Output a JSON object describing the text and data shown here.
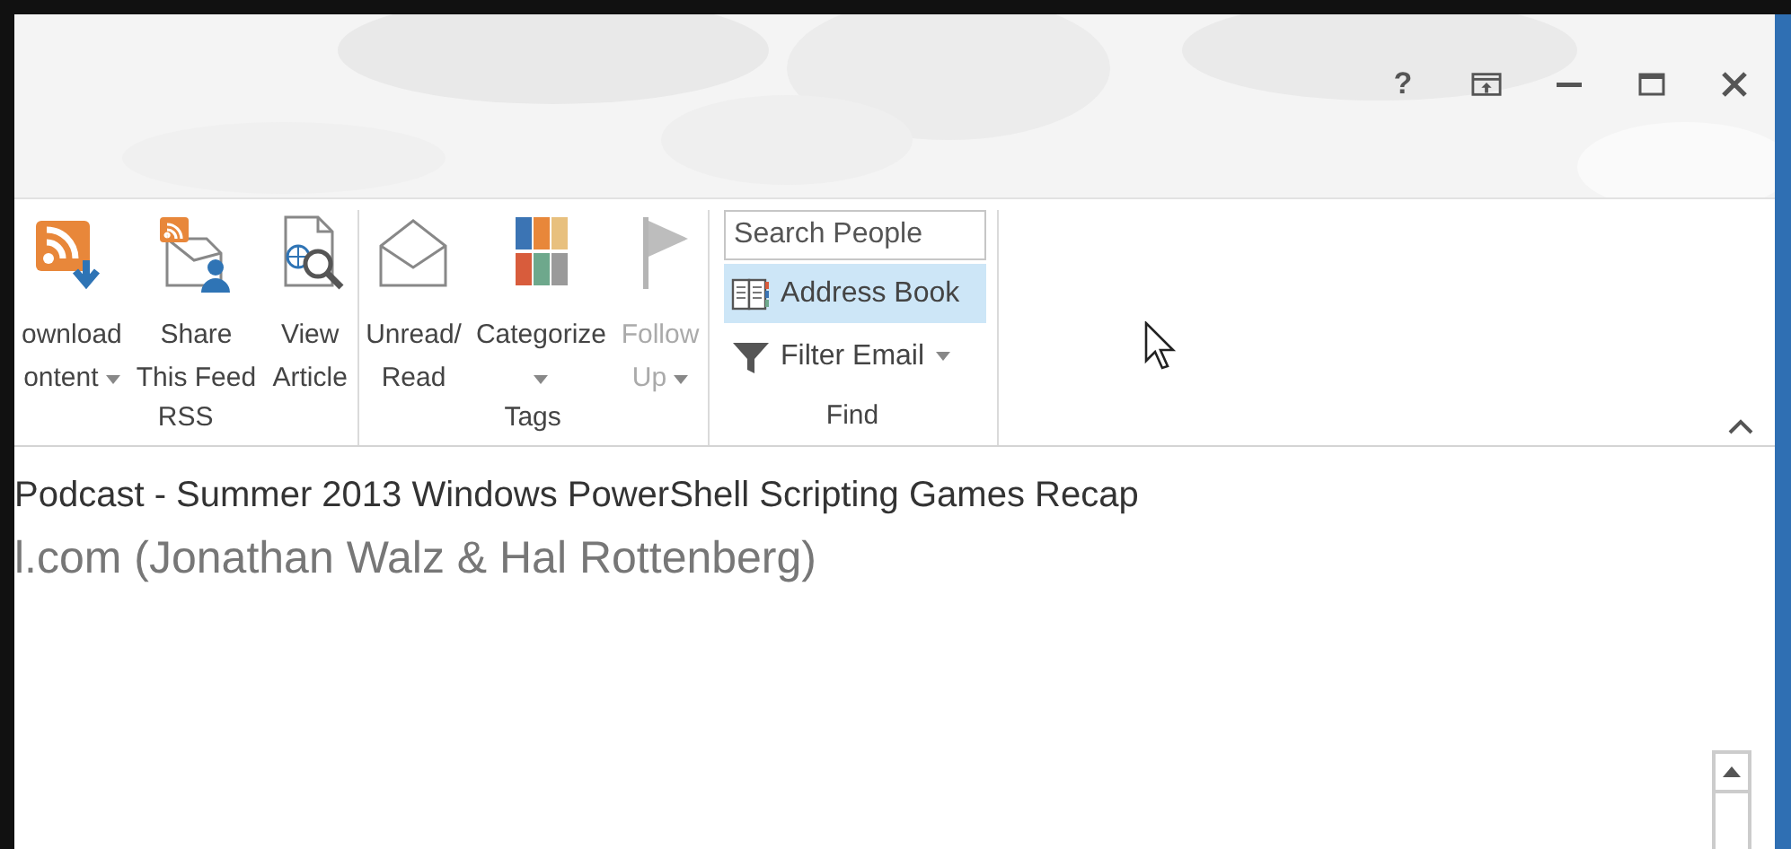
{
  "title_bar": {
    "controls": [
      {
        "kind": "help",
        "text": "?"
      },
      {
        "kind": "ribbon-display"
      },
      {
        "kind": "minimize"
      },
      {
        "kind": "maximize"
      },
      {
        "kind": "close"
      }
    ]
  },
  "ribbon": {
    "groups": [
      {
        "label": "RSS",
        "items": [
          {
            "kind": "large",
            "lines": [
              "ownload",
              "ontent"
            ],
            "dropdown": true,
            "disabled": false
          },
          {
            "kind": "large",
            "lines": [
              "Share",
              "This Feed"
            ],
            "dropdown": false,
            "disabled": false
          },
          {
            "kind": "large",
            "lines": [
              "View",
              "Article"
            ],
            "dropdown": false,
            "disabled": false
          }
        ]
      },
      {
        "label": "Tags",
        "items": [
          {
            "kind": "large",
            "lines": [
              "Unread/",
              "Read"
            ],
            "dropdown": false,
            "disabled": false
          },
          {
            "kind": "large",
            "lines": [
              "Categorize"
            ],
            "dropdown": true,
            "disabled": false
          },
          {
            "kind": "large",
            "lines": [
              "Follow",
              "Up"
            ],
            "dropdown": true,
            "disabled": true
          }
        ]
      },
      {
        "label": "Find",
        "items": [
          {
            "kind": "search",
            "placeholder": "Search People"
          },
          {
            "kind": "small",
            "label": "Address Book",
            "dropdown": false,
            "selected": true
          },
          {
            "kind": "small",
            "label": "Filter Email",
            "dropdown": true,
            "selected": false
          }
        ]
      }
    ]
  },
  "message": {
    "subject": "Podcast - Summer 2013 Windows PowerShell Scripting Games Recap",
    "from": "l.com (Jonathan Walz & Hal Rottenberg)"
  }
}
